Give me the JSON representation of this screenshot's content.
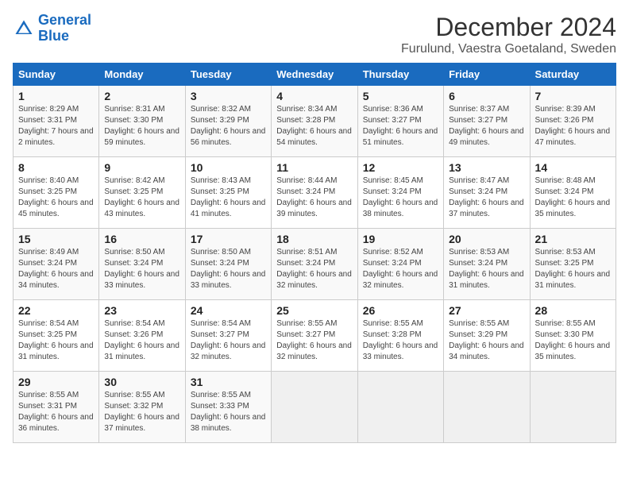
{
  "logo": {
    "text_general": "General",
    "text_blue": "Blue"
  },
  "title": "December 2024",
  "subtitle": "Furulund, Vaestra Goetaland, Sweden",
  "days_of_week": [
    "Sunday",
    "Monday",
    "Tuesday",
    "Wednesday",
    "Thursday",
    "Friday",
    "Saturday"
  ],
  "weeks": [
    [
      {
        "day": "1",
        "sunrise": "Sunrise: 8:29 AM",
        "sunset": "Sunset: 3:31 PM",
        "daylight": "Daylight: 7 hours and 2 minutes."
      },
      {
        "day": "2",
        "sunrise": "Sunrise: 8:31 AM",
        "sunset": "Sunset: 3:30 PM",
        "daylight": "Daylight: 6 hours and 59 minutes."
      },
      {
        "day": "3",
        "sunrise": "Sunrise: 8:32 AM",
        "sunset": "Sunset: 3:29 PM",
        "daylight": "Daylight: 6 hours and 56 minutes."
      },
      {
        "day": "4",
        "sunrise": "Sunrise: 8:34 AM",
        "sunset": "Sunset: 3:28 PM",
        "daylight": "Daylight: 6 hours and 54 minutes."
      },
      {
        "day": "5",
        "sunrise": "Sunrise: 8:36 AM",
        "sunset": "Sunset: 3:27 PM",
        "daylight": "Daylight: 6 hours and 51 minutes."
      },
      {
        "day": "6",
        "sunrise": "Sunrise: 8:37 AM",
        "sunset": "Sunset: 3:27 PM",
        "daylight": "Daylight: 6 hours and 49 minutes."
      },
      {
        "day": "7",
        "sunrise": "Sunrise: 8:39 AM",
        "sunset": "Sunset: 3:26 PM",
        "daylight": "Daylight: 6 hours and 47 minutes."
      }
    ],
    [
      {
        "day": "8",
        "sunrise": "Sunrise: 8:40 AM",
        "sunset": "Sunset: 3:25 PM",
        "daylight": "Daylight: 6 hours and 45 minutes."
      },
      {
        "day": "9",
        "sunrise": "Sunrise: 8:42 AM",
        "sunset": "Sunset: 3:25 PM",
        "daylight": "Daylight: 6 hours and 43 minutes."
      },
      {
        "day": "10",
        "sunrise": "Sunrise: 8:43 AM",
        "sunset": "Sunset: 3:25 PM",
        "daylight": "Daylight: 6 hours and 41 minutes."
      },
      {
        "day": "11",
        "sunrise": "Sunrise: 8:44 AM",
        "sunset": "Sunset: 3:24 PM",
        "daylight": "Daylight: 6 hours and 39 minutes."
      },
      {
        "day": "12",
        "sunrise": "Sunrise: 8:45 AM",
        "sunset": "Sunset: 3:24 PM",
        "daylight": "Daylight: 6 hours and 38 minutes."
      },
      {
        "day": "13",
        "sunrise": "Sunrise: 8:47 AM",
        "sunset": "Sunset: 3:24 PM",
        "daylight": "Daylight: 6 hours and 37 minutes."
      },
      {
        "day": "14",
        "sunrise": "Sunrise: 8:48 AM",
        "sunset": "Sunset: 3:24 PM",
        "daylight": "Daylight: 6 hours and 35 minutes."
      }
    ],
    [
      {
        "day": "15",
        "sunrise": "Sunrise: 8:49 AM",
        "sunset": "Sunset: 3:24 PM",
        "daylight": "Daylight: 6 hours and 34 minutes."
      },
      {
        "day": "16",
        "sunrise": "Sunrise: 8:50 AM",
        "sunset": "Sunset: 3:24 PM",
        "daylight": "Daylight: 6 hours and 33 minutes."
      },
      {
        "day": "17",
        "sunrise": "Sunrise: 8:50 AM",
        "sunset": "Sunset: 3:24 PM",
        "daylight": "Daylight: 6 hours and 33 minutes."
      },
      {
        "day": "18",
        "sunrise": "Sunrise: 8:51 AM",
        "sunset": "Sunset: 3:24 PM",
        "daylight": "Daylight: 6 hours and 32 minutes."
      },
      {
        "day": "19",
        "sunrise": "Sunrise: 8:52 AM",
        "sunset": "Sunset: 3:24 PM",
        "daylight": "Daylight: 6 hours and 32 minutes."
      },
      {
        "day": "20",
        "sunrise": "Sunrise: 8:53 AM",
        "sunset": "Sunset: 3:24 PM",
        "daylight": "Daylight: 6 hours and 31 minutes."
      },
      {
        "day": "21",
        "sunrise": "Sunrise: 8:53 AM",
        "sunset": "Sunset: 3:25 PM",
        "daylight": "Daylight: 6 hours and 31 minutes."
      }
    ],
    [
      {
        "day": "22",
        "sunrise": "Sunrise: 8:54 AM",
        "sunset": "Sunset: 3:25 PM",
        "daylight": "Daylight: 6 hours and 31 minutes."
      },
      {
        "day": "23",
        "sunrise": "Sunrise: 8:54 AM",
        "sunset": "Sunset: 3:26 PM",
        "daylight": "Daylight: 6 hours and 31 minutes."
      },
      {
        "day": "24",
        "sunrise": "Sunrise: 8:54 AM",
        "sunset": "Sunset: 3:27 PM",
        "daylight": "Daylight: 6 hours and 32 minutes."
      },
      {
        "day": "25",
        "sunrise": "Sunrise: 8:55 AM",
        "sunset": "Sunset: 3:27 PM",
        "daylight": "Daylight: 6 hours and 32 minutes."
      },
      {
        "day": "26",
        "sunrise": "Sunrise: 8:55 AM",
        "sunset": "Sunset: 3:28 PM",
        "daylight": "Daylight: 6 hours and 33 minutes."
      },
      {
        "day": "27",
        "sunrise": "Sunrise: 8:55 AM",
        "sunset": "Sunset: 3:29 PM",
        "daylight": "Daylight: 6 hours and 34 minutes."
      },
      {
        "day": "28",
        "sunrise": "Sunrise: 8:55 AM",
        "sunset": "Sunset: 3:30 PM",
        "daylight": "Daylight: 6 hours and 35 minutes."
      }
    ],
    [
      {
        "day": "29",
        "sunrise": "Sunrise: 8:55 AM",
        "sunset": "Sunset: 3:31 PM",
        "daylight": "Daylight: 6 hours and 36 minutes."
      },
      {
        "day": "30",
        "sunrise": "Sunrise: 8:55 AM",
        "sunset": "Sunset: 3:32 PM",
        "daylight": "Daylight: 6 hours and 37 minutes."
      },
      {
        "day": "31",
        "sunrise": "Sunrise: 8:55 AM",
        "sunset": "Sunset: 3:33 PM",
        "daylight": "Daylight: 6 hours and 38 minutes."
      },
      null,
      null,
      null,
      null
    ]
  ]
}
